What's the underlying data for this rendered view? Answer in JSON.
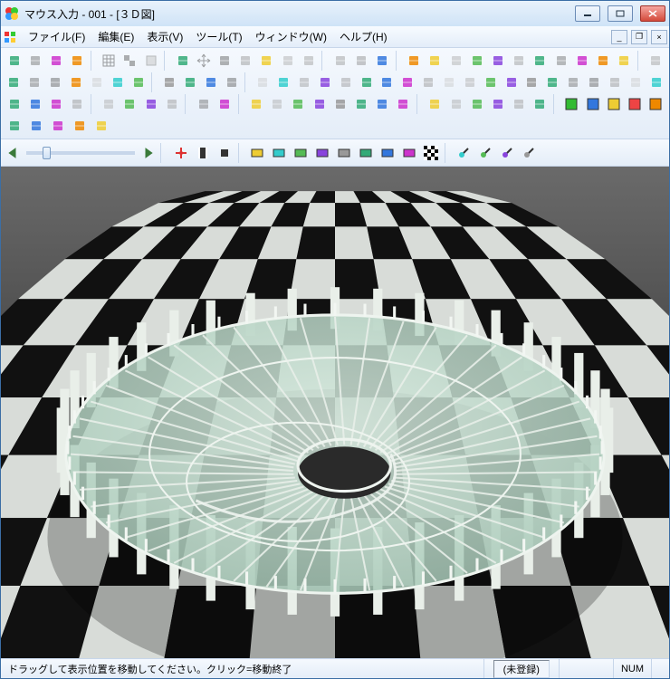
{
  "window": {
    "title": "マウス入力 - 001 - [３Ｄ図]"
  },
  "menu": {
    "file": "ファイル(F)",
    "edit": "編集(E)",
    "view": "表示(V)",
    "tool": "ツール(T)",
    "window": "ウィンドウ(W)",
    "help": "ヘルプ(H)"
  },
  "status": {
    "hint": "ドラッグして表示位置を移動してください。クリック=移動終了",
    "slot1": "(未登録)",
    "slot2": "NUM"
  },
  "colors": {
    "titlebar_start": "#e8f2fb",
    "titlebar_end": "#cfe3f7",
    "close_red": "#d44a3a",
    "glass_green": "#b8d6c5"
  },
  "icons": {
    "app": "app-icon",
    "minimize": "minimize-icon",
    "maximize": "maximize-icon",
    "close": "close-icon"
  },
  "toolbar_rows": [
    [
      "new",
      "print",
      "preview",
      "props",
      "|",
      "grid",
      "snap-blue",
      "snap-yellow",
      "|",
      "zoom-target",
      "move-cross",
      "zoom-region",
      "arrow",
      "redo-x",
      "undo",
      "redo",
      "|",
      "render1",
      "render2",
      "render3",
      "|",
      "sun1",
      "sun2",
      "sun3",
      "sun4",
      "sun5",
      "sun6",
      "sun7",
      "sun8",
      "sun9",
      "sun10",
      "sun11",
      "|",
      "shade"
    ],
    [
      "shape1",
      "shape2",
      "shape3",
      "shape4",
      "shape5",
      "shape6",
      "shape7",
      "|",
      "line1",
      "line2",
      "line3",
      "line4",
      "|",
      "surf1",
      "surf2",
      "surf3",
      "surf4",
      "surf5",
      "surf6",
      "surf7",
      "surf8",
      "surf9",
      "surf10",
      "surf11",
      "surf12",
      "surf13",
      "surf14",
      "surf15",
      "surf16",
      "surf17",
      "surf18",
      "surf19",
      "surf20"
    ],
    [
      "mat1",
      "mat2",
      "mat3",
      "mat4",
      "|",
      "panel1",
      "panel2",
      "panel3",
      "panel4",
      "|",
      "text-a1",
      "text-a2",
      "|",
      "ta1",
      "ta2",
      "ta3",
      "ta4",
      "ta5",
      "ta6",
      "ta7",
      "ta8",
      "|",
      "ar1",
      "ar2",
      "ar3",
      "ar4",
      "ar5",
      "ar6",
      "|",
      "c-green",
      "c-blue",
      "c-yellow",
      "c-red",
      "c-orange"
    ],
    [
      "opt1",
      "opt2",
      "opt3",
      "opt4",
      "opt5"
    ],
    []
  ],
  "slider_tools": [
    "nav-cross",
    "film",
    "stop",
    "|",
    "layer-g",
    "layer-b",
    "layer-m",
    "layer-o",
    "layer-y",
    "layer-c",
    "layer-g2",
    "layer-v",
    "checker",
    "|",
    "brush1",
    "brush2",
    "brush3",
    "brush4"
  ]
}
